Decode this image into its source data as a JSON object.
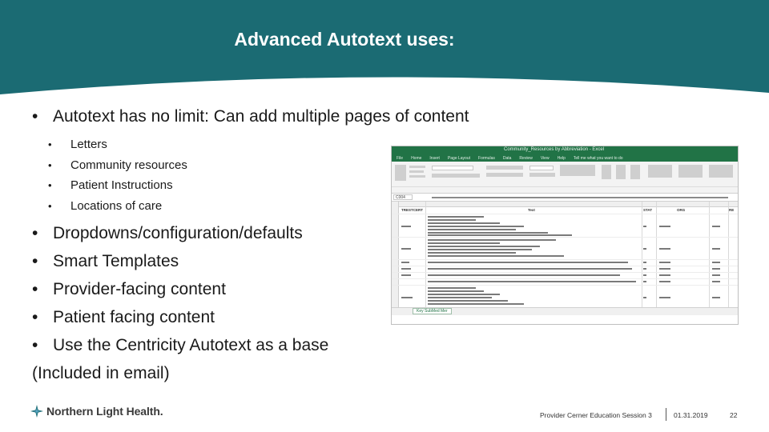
{
  "slide": {
    "title": "Advanced Autotext uses:",
    "bullets": {
      "first": "Autotext has no limit: Can add multiple pages of content",
      "sub": [
        "Letters",
        "Community resources",
        "Patient Instructions",
        "Locations of care"
      ],
      "rest": [
        "Dropdowns/configuration/defaults",
        "Smart Templates",
        "Provider-facing content",
        "Patient facing content",
        "Use the Centricity Autotext as a base"
      ],
      "note": "(Included in email)"
    }
  },
  "excel": {
    "title": "Community_Resources by Abbreviation - Excel",
    "tabs": [
      "File",
      "Home",
      "Insert",
      "Page Layout",
      "Formulas",
      "Data",
      "Review",
      "View",
      "Help",
      "Tell me what you want to do"
    ],
    "namebox": "C004",
    "headers": [
      "TRESTCERT",
      "Text",
      "STAT",
      "ORG",
      "RE"
    ],
    "sheet_tab": "Key SubMed Mer",
    "colors": {
      "ribbon": "#217346"
    }
  },
  "footer": {
    "logo": "Northern Light Health.",
    "session": "Provider Cerner Education Session 3",
    "date": "01.31.2019",
    "page": "22"
  },
  "colors": {
    "banner": "#1b6b73"
  }
}
